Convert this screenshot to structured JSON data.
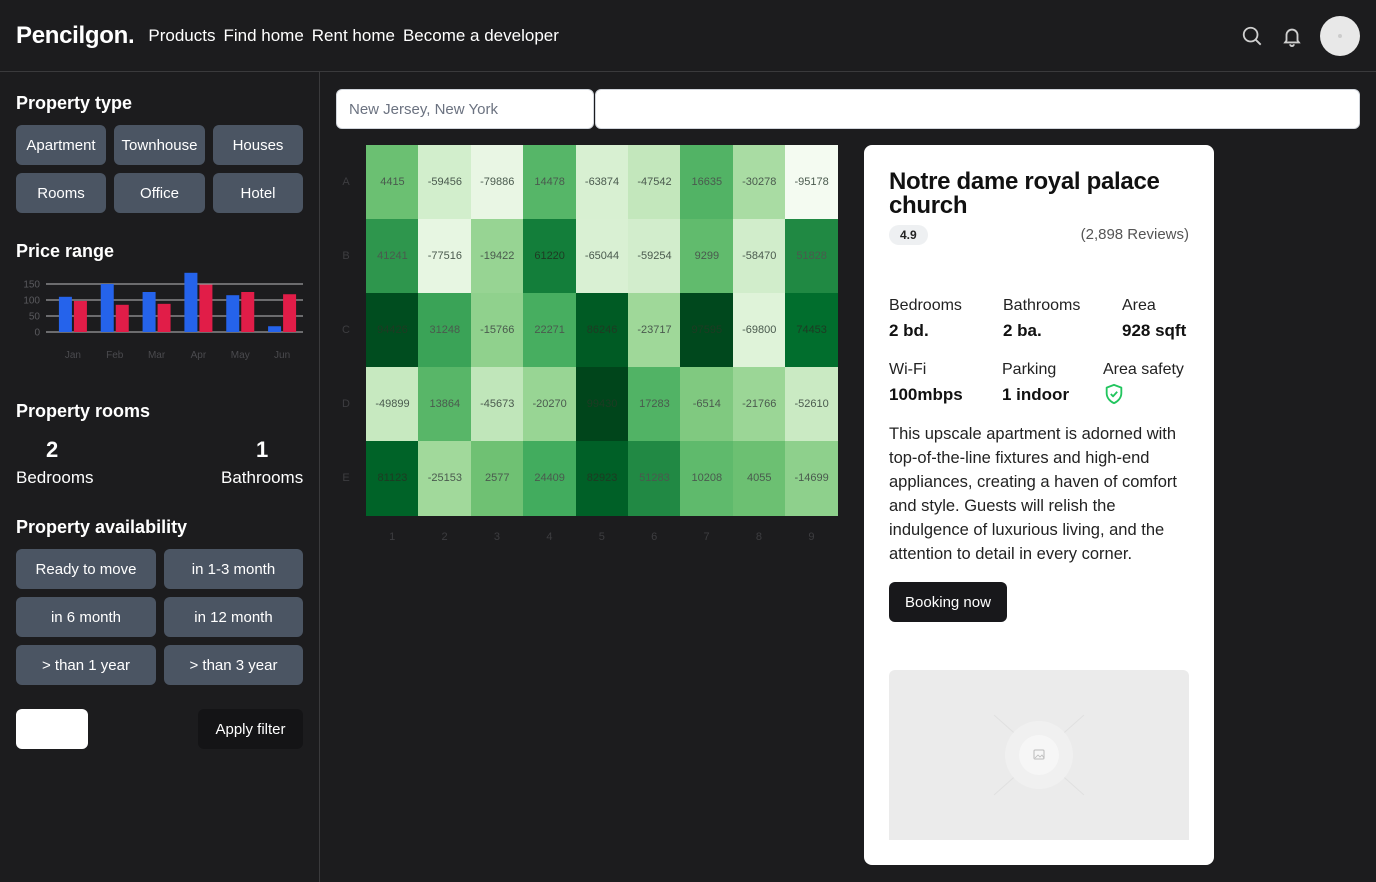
{
  "header": {
    "logo": "Pencilgon.",
    "nav": [
      "Products",
      "Find home",
      "Rent home",
      "Become a developer"
    ],
    "icons": [
      "search-icon",
      "bell-icon"
    ]
  },
  "sidebar": {
    "property_type": {
      "title": "Property type",
      "options": [
        "Apartment",
        "Townhouse",
        "Houses",
        "Rooms",
        "Office",
        "Hotel"
      ]
    },
    "price_range": {
      "title": "Price range",
      "chart_data": {
        "type": "bar",
        "categories": [
          "Jan",
          "Feb",
          "Mar",
          "Apr",
          "May",
          "Jun"
        ],
        "series": [
          {
            "values": [
              110,
              150,
              125,
              185,
              115,
              18
            ],
            "color": "#2563eb"
          },
          {
            "values": [
              97,
              85,
              88,
              148,
              125,
              118
            ],
            "color": "#e11d48"
          }
        ],
        "yticks": [
          0,
          50,
          100,
          150
        ],
        "ylim": [
          0,
          150
        ]
      }
    },
    "property_rooms": {
      "title": "Property rooms",
      "bedrooms_count": "2",
      "bedrooms_label": "Bedrooms",
      "bathrooms_count": "1",
      "bathrooms_label": "Bathrooms"
    },
    "availability": {
      "title": "Property availability",
      "options": [
        "Ready to move",
        "in 1-3 month",
        "in 6 month",
        "in 12 month",
        "> than 1 year",
        "> than 3 year"
      ]
    },
    "apply_label": "Apply filter"
  },
  "search": {
    "location_placeholder": "New Jersey, New York"
  },
  "heatmap": {
    "chart_data": {
      "type": "heatmap",
      "rows": [
        "A",
        "B",
        "C",
        "D",
        "E"
      ],
      "cols": [
        "1",
        "2",
        "3",
        "4",
        "5",
        "6",
        "7",
        "8",
        "9"
      ],
      "values": [
        [
          4415,
          -59456,
          -79886,
          14478,
          -63874,
          -47542,
          16635,
          -30278,
          -95178
        ],
        [
          41241,
          -77516,
          -19422,
          61220,
          -65044,
          -59254,
          9299,
          -58470,
          51828
        ],
        [
          94426,
          31248,
          -15766,
          22271,
          86246,
          -23717,
          97595,
          -69800,
          74453
        ],
        [
          -49899,
          13864,
          -45673,
          -20270,
          99430,
          17283,
          -6514,
          -21766,
          -52610
        ],
        [
          81123,
          -25153,
          2577,
          24409,
          82923,
          51283,
          10208,
          4055,
          -14699
        ]
      ],
      "colorscale": "Greens"
    }
  },
  "card": {
    "title": "Notre dame royal palace church",
    "rating": "4.9",
    "reviews": "(2,898 Reviews)",
    "features": [
      {
        "label": "Bedrooms",
        "value": "2 bd."
      },
      {
        "label": "Bathrooms",
        "value": "2 ba."
      },
      {
        "label": "Area",
        "value": "928 sqft"
      },
      {
        "label": "Wi-Fi",
        "value": "100mbps"
      },
      {
        "label": "Parking",
        "value": "1 indoor"
      },
      {
        "label": "Area safety",
        "value": "shield-check-icon"
      }
    ],
    "description": "This upscale apartment is adorned with top-of-the-line fixtures and high-end appliances, creating a haven of comfort and style. Guests will relish the indulgence of luxurious living, and the attention to detail in every corner.",
    "book_label": "Booking now"
  }
}
